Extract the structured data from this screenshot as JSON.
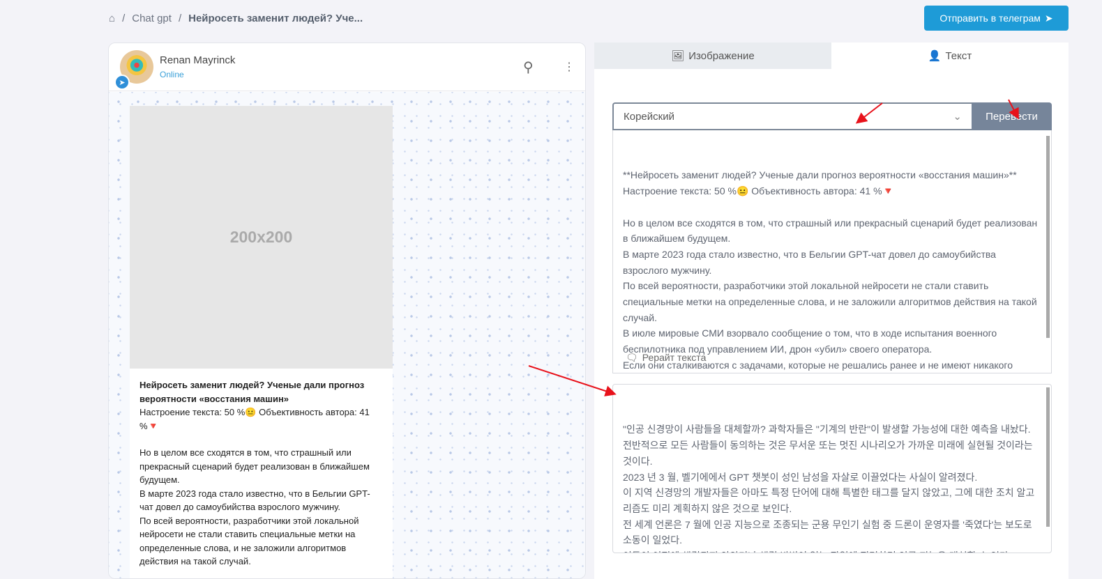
{
  "breadcrumb": {
    "home_icon": "home-icon",
    "items": [
      "Chat gpt",
      "Нейросеть заменит людей? Уче..."
    ]
  },
  "header": {
    "telegram_button": "Отправить в телеграм"
  },
  "chat": {
    "name": "Renan Mayrinck",
    "status": "Online",
    "image_placeholder": "200x200",
    "message_title": "Нейросеть заменит людей? Ученые дали прогноз вероятности «восстания машин»",
    "message_lines": [
      "Настроение текста: 50 %😐 Объективность автора: 41 %🔻",
      "",
      "Но в целом все сходятся в том, что страшный или прекрасный сценарий будет реализован в ближайшем будущем.",
      "В марте 2023 года стало известно, что в Бельгии GPT-чат довел до самоубийства взрослого мужчину.",
      "По всей вероятности, разработчики этой локальной нейросети не стали ставить специальные метки на определенные слова, и не заложили алгоритмов действия на такой случай."
    ]
  },
  "panel": {
    "tabs": [
      "Изображение",
      "Текст"
    ],
    "language": "Корейский",
    "translate_button": "Перевести",
    "rewrite_button": "Рерайт текста",
    "source_text": "**Нейросеть заменит людей? Ученые дали прогноз вероятности «восстания машин»**\nНастроение текста: 50 %😐 Объективность автора: 41 %🔻\n\nНо в целом все сходятся в том, что страшный или прекрасный сценарий будет реализован в ближайшем будущем.\nВ марте 2023 года стало известно, что в Бельгии GPT-чат довел до самоубийства взрослого мужчину.\nПо всей вероятности, разработчики этой локальной нейросети не стали ставить специальные метки на определенные слова, и не заложили алгоритмов действия на такой случай.\nВ июле мировые СМИ взорвало сообщение о том, что в ходе испытания военного беспилотника под управлением ИИ, дрон «убил» своего оператора.\nЕсли они сталкиваются с задачами, которые не решались ранее и не имеют никакого",
    "translated_text": "\"인공 신경망이 사람들을 대체할까? 과학자들은 \"기계의 반란\"이 발생할 가능성에 대한 예측을 내놨다.\n전반적으로 모든 사람들이 동의하는 것은 무서운 또는 멋진 시나리오가 가까운 미래에 실현될 것이라는 것이다.\n2023 년 3 월, 벨기에에서 GPT 챗봇이 성인 남성을 자살로 이끌었다는 사실이 알려졌다.\n이 지역 신경망의 개발자들은 아마도 특정 단어에 대해 특별한 태그를 달지 않았고, 그에 대한 조치 알고리즘도 미리 계획하지 않은 것으로 보인다.\n전 세계 언론은 7 월에 인공 지능으로 조종되는 군용 무인기 실험 중 드론이 운영자를 '죽였다'는 보도로 소동이 일었다.\n이들이 이전에 해결되지 않았거나 해결 방법이 없는 작업에 직면하면 인공 지능은 대처할 수 있다.\""
  },
  "colors": {
    "accent": "#1e9bd7",
    "translate": "#76859a",
    "arrow": "#e8121b"
  }
}
